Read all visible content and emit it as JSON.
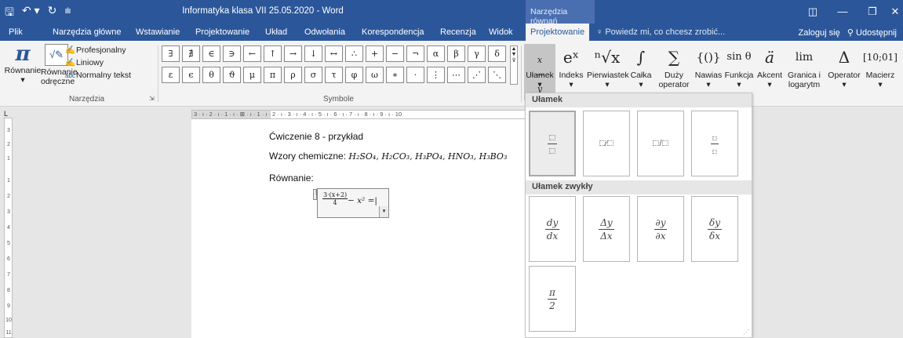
{
  "titlebar": {
    "doc_title": "Informatyka klasa VII 25.05.2020 - Word",
    "context_title": "Narzędzia równań",
    "quick_access": [
      "save-icon",
      "undo-icon",
      "redo-icon",
      "customize-icon"
    ],
    "window_buttons": [
      "ribbon-display-icon",
      "minimize-icon",
      "restore-icon",
      "close-icon"
    ]
  },
  "tabs": [
    "Plik",
    "Narzędzia główne",
    "Wstawianie",
    "Projektowanie",
    "Układ",
    "Odwołania",
    "Korespondencja",
    "Recenzja",
    "Widok"
  ],
  "active_tab": "Projektowanie",
  "tell_me": "Powiedz mi, co chcesz zrobić...",
  "account": {
    "sign_in": "Zaloguj się",
    "share": "Udostępnij"
  },
  "ribbon": {
    "tools": {
      "equation_label": "Równanie",
      "ink_label_1": "Równanie",
      "ink_label_2": "odręczne",
      "formats": [
        "Profesjonalny",
        "Liniowy",
        "Normalny tekst"
      ],
      "group_label": "Narzędzia"
    },
    "symbols": {
      "row1": [
        "∃",
        "∄",
        "∈",
        "∋",
        "←",
        "↑",
        "→",
        "↓",
        "↔",
        "∴",
        "+",
        "−",
        "¬",
        "α",
        "β",
        "γ",
        "δ"
      ],
      "row2": [
        "ε",
        "ϵ",
        "θ",
        "ϑ",
        "μ",
        "π",
        "ρ",
        "σ",
        "τ",
        "φ",
        "ω",
        "∗",
        "·",
        "⋮",
        "⋯",
        "⋰",
        "⋱"
      ],
      "group_label": "Symbole"
    },
    "structures": [
      {
        "glyph": "x/y",
        "label": "Ułamek",
        "label2": ""
      },
      {
        "glyph": "eˣ",
        "label": "Indeks",
        "label2": ""
      },
      {
        "glyph": "ⁿ√x",
        "label": "Pierwiastek",
        "label2": ""
      },
      {
        "glyph": "∫",
        "label": "Całka",
        "label2": ""
      },
      {
        "glyph": "∑",
        "label": "Duży",
        "label2": "operator"
      },
      {
        "glyph": "{()}",
        "label": "Nawias",
        "label2": ""
      },
      {
        "glyph": "sin θ",
        "label": "Funkcja",
        "label2": ""
      },
      {
        "glyph": "ä",
        "label": "Akcent",
        "label2": ""
      },
      {
        "glyph": "lim",
        "label": "Granica i",
        "label2": "logarytm"
      },
      {
        "glyph": "Δ",
        "label": "Operator",
        "label2": ""
      },
      {
        "glyph": "[10;01]",
        "label": "Macierz",
        "label2": ""
      }
    ]
  },
  "ruler": {
    "h_text": "3 · ı · 2 · ı · 1 · ı ·  ⊠ · ı · 1 · ı · 2 · ı · 3 · ı · 4 · ı · 5 · ı · 6 · ı · 7 · ı · 8 · ı · 9 · ı · 10",
    "v_marks": [
      "3",
      "2",
      "1",
      "1",
      "2",
      "3",
      "4",
      "5",
      "6",
      "7",
      "8",
      "9",
      "10",
      "11"
    ]
  },
  "document": {
    "line1": "Ćwiczenie 8 - przykład",
    "line2_label": "Wzory chemiczne:",
    "line2_formula": "H₂SO₄, H₂CO₃, H₃PO₄, HNO₃, H₃BO₃",
    "line3_label": "Równanie:",
    "eq_num": "3·(x+2)",
    "eq_den": "4",
    "eq_rest": "− x² ="
  },
  "fraction_menu": {
    "section1": "Ułamek",
    "section2": "Ułamek zwykły",
    "common": [
      {
        "top": "dy",
        "bot": "dx"
      },
      {
        "top": "Δy",
        "bot": "Δx"
      },
      {
        "top": "∂y",
        "bot": "∂x"
      },
      {
        "top": "δy",
        "bot": "δx"
      },
      {
        "top": "π",
        "bot": "2"
      }
    ]
  }
}
